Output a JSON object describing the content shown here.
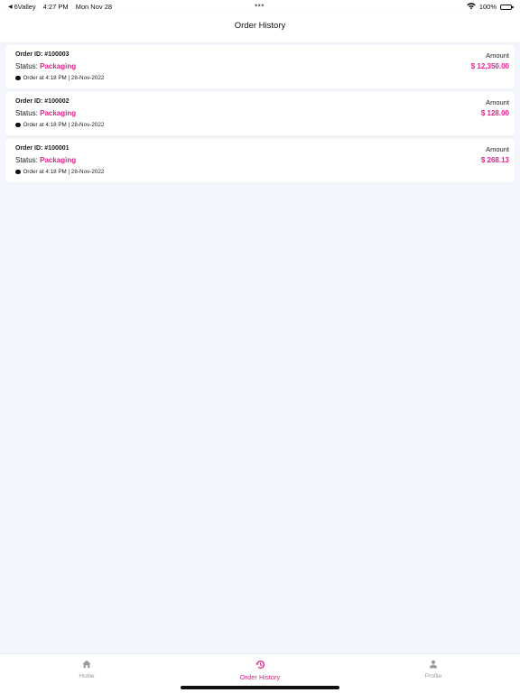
{
  "status_bar": {
    "back_app": "6Valley",
    "time": "4:27 PM",
    "date": "Mon Nov 28",
    "dots": "•••",
    "battery": "100%"
  },
  "header": {
    "title": "Order History"
  },
  "orders": [
    {
      "id_label": "Order ID: #100003",
      "status_prefix": "Status: ",
      "status": "Packaging",
      "date": "Order at 4:18 PM | 28-Nov-2022",
      "amount_label": "Amount",
      "amount": "$ 12,350.00"
    },
    {
      "id_label": "Order ID: #100002",
      "status_prefix": "Status: ",
      "status": "Packaging",
      "date": "Order at 4:18 PM | 28-Nov-2022",
      "amount_label": "Amount",
      "amount": "$ 128.00"
    },
    {
      "id_label": "Order ID: #100001",
      "status_prefix": "Status: ",
      "status": "Packaging",
      "date": "Order at 4:18 PM | 28-Nov-2022",
      "amount_label": "Amount",
      "amount": "$ 268.13"
    }
  ],
  "bottom_nav": {
    "home": {
      "label": "Home",
      "icon": "home-icon"
    },
    "orders": {
      "label": "Order History",
      "icon": "history-icon",
      "active": true
    },
    "profile": {
      "label": "Profile",
      "icon": "person-icon"
    }
  },
  "colors": {
    "accent": "#e0218a",
    "background": "#f4f6fd"
  }
}
